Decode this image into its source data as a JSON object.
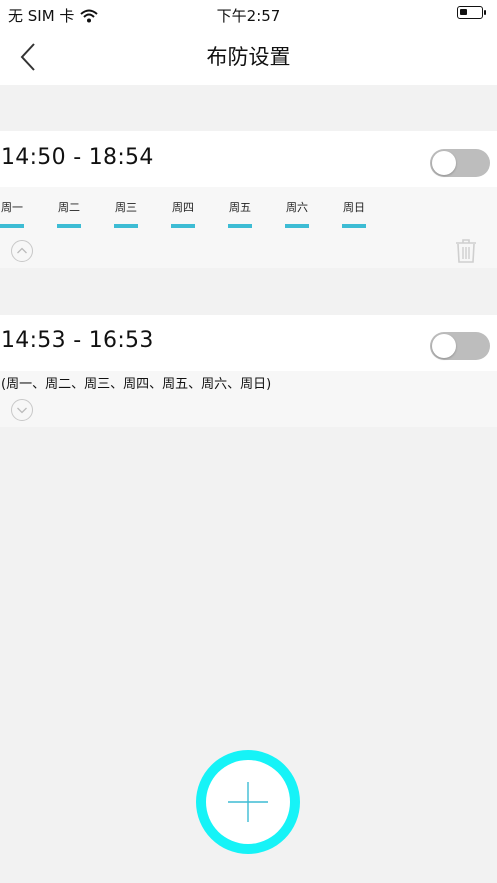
{
  "status_bar": {
    "carrier": "无 SIM 卡",
    "time": "下午2:57",
    "battery_level": 0.35
  },
  "nav": {
    "title": "布防设置",
    "back_icon": "chevron-left-icon"
  },
  "schedules": [
    {
      "time_range": "14:50 - 18:54",
      "enabled": false,
      "expanded": true,
      "days": [
        "周一",
        "周二",
        "周三",
        "周四",
        "周五",
        "周六",
        "周日"
      ],
      "collapse_icon": "chevron-up-circle-icon",
      "delete_icon": "trash-icon"
    },
    {
      "time_range": "14:53 - 16:53",
      "enabled": false,
      "expanded": false,
      "days_summary": "(周一、周二、周三、周四、周五、周六、周日)",
      "expand_icon": "chevron-down-circle-icon"
    }
  ],
  "fab": {
    "icon": "plus-icon"
  },
  "colors": {
    "accent": "#3dbcd4",
    "fab_ring": "#16f3f7",
    "toggle_off": "#bdbdbd",
    "background": "#f2f2f2"
  }
}
